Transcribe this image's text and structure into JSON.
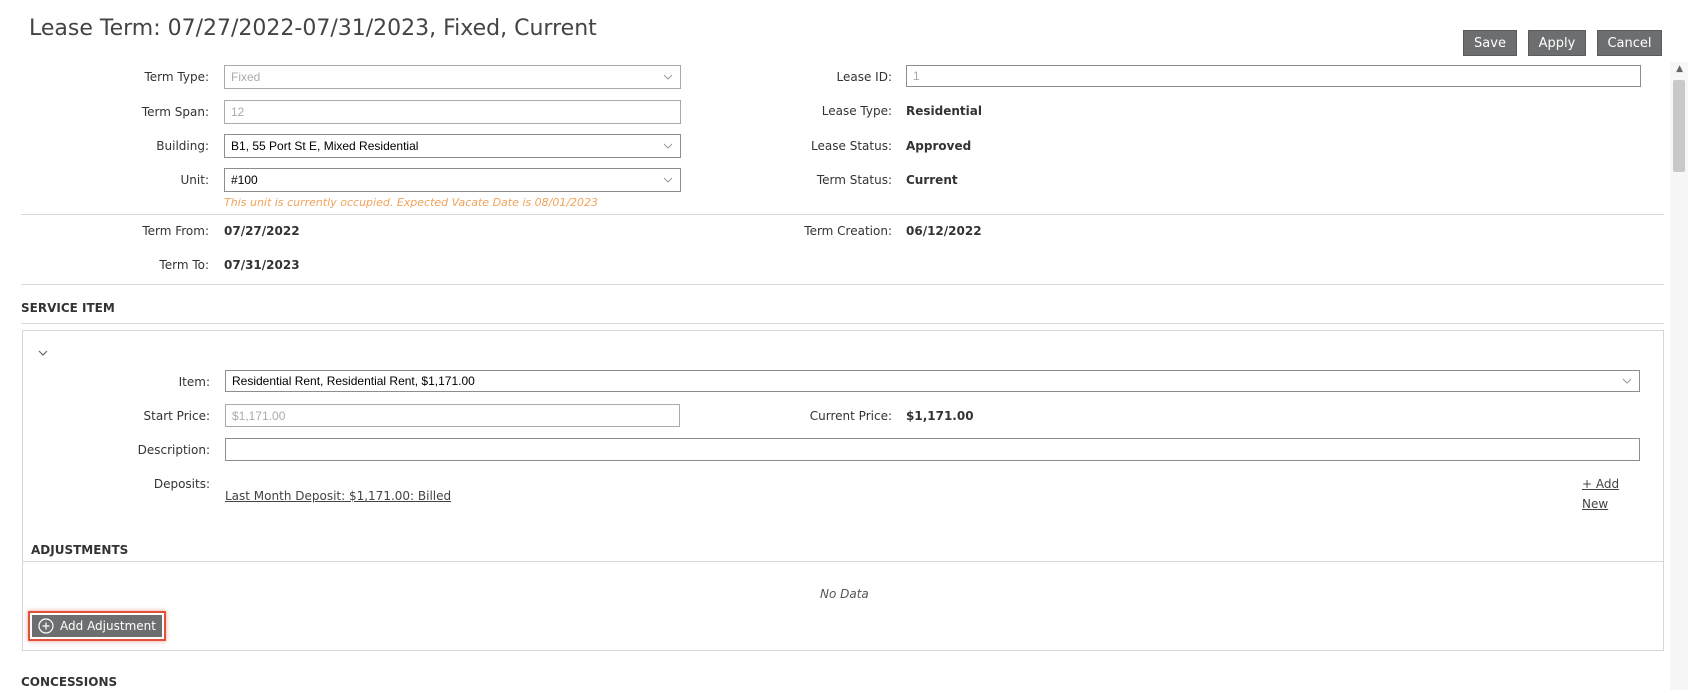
{
  "header": {
    "title": "Lease Term: 07/27/2022-07/31/2023, Fixed, Current",
    "save_label": "Save",
    "apply_label": "Apply",
    "cancel_label": "Cancel"
  },
  "form": {
    "term_type_label": "Term Type:",
    "term_type_value": "Fixed",
    "term_span_label": "Term Span:",
    "term_span_value": "12",
    "building_label": "Building:",
    "building_value": "B1,  55 Port St E, Mixed Residential",
    "unit_label": "Unit:",
    "unit_value": "#100",
    "unit_warning": "This unit is currently occupied. Expected Vacate Date is 08/01/2023",
    "lease_id_label": "Lease ID:",
    "lease_id_value": "1",
    "lease_type_label": "Lease Type:",
    "lease_type_value": "Residential",
    "lease_status_label": "Lease Status:",
    "lease_status_value": "Approved",
    "term_status_label": "Term Status:",
    "term_status_value": "Current",
    "term_from_label": "Term From:",
    "term_from_value": "07/27/2022",
    "term_to_label": "Term To:",
    "term_to_value": "07/31/2023",
    "term_creation_label": "Term Creation:",
    "term_creation_value": "06/12/2022"
  },
  "service_item": {
    "section_title": "SERVICE ITEM",
    "item_label": "Item:",
    "item_value": "Residential Rent, Residential Rent, $1,171.00",
    "start_price_label": "Start Price:",
    "start_price_value": "$1,171.00",
    "current_price_label": "Current Price:",
    "current_price_value": "$1,171.00",
    "description_label": "Description:",
    "description_value": "",
    "deposits_label": "Deposits:",
    "deposit_link": "Last Month Deposit: $1,171.00: Billed",
    "add_new_line1": "+ Add",
    "add_new_line2": "New"
  },
  "adjustments": {
    "section_title": "ADJUSTMENTS",
    "empty_text": "No Data",
    "add_button_label": "Add Adjustment"
  },
  "concessions": {
    "section_title": "CONCESSIONS"
  },
  "icons": {
    "chevron": "chevron-down-icon",
    "plus_circle": "plus-circle-icon"
  }
}
